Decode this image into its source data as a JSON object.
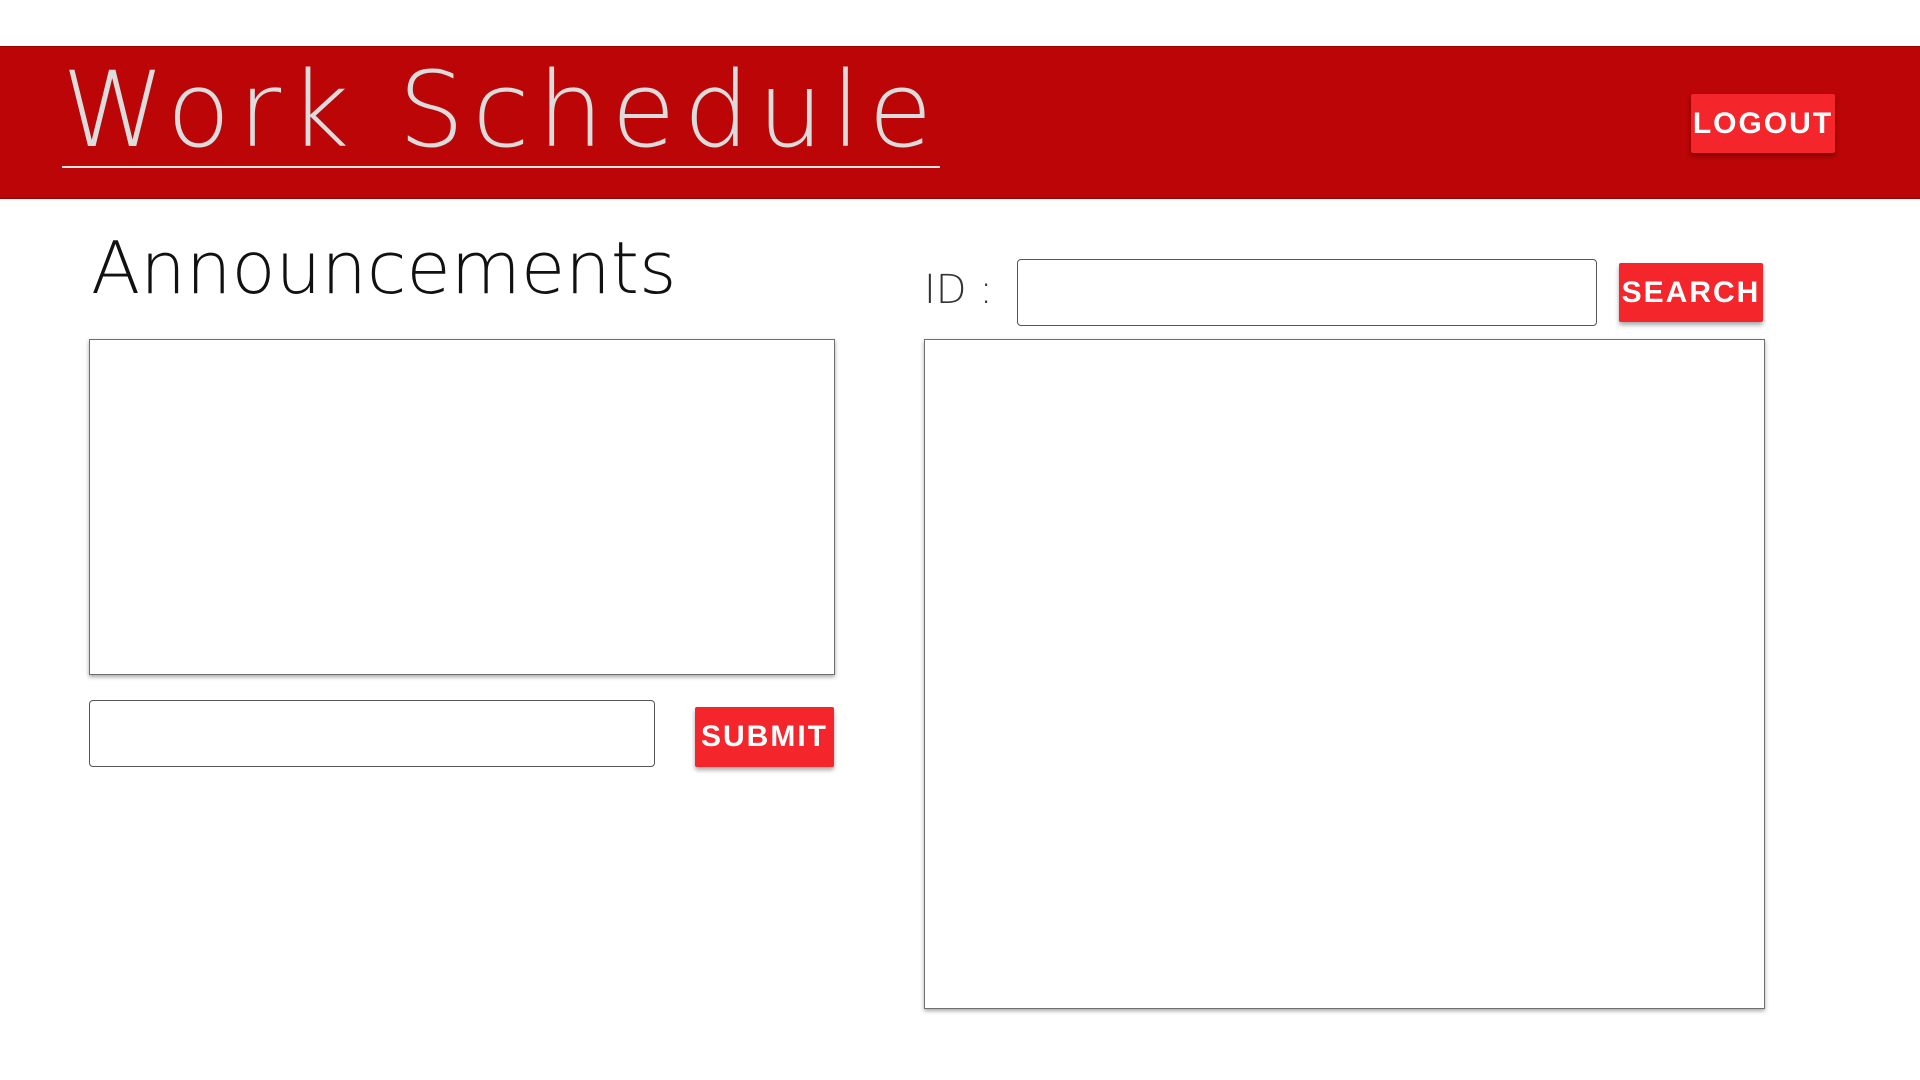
{
  "header": {
    "title": "Work Schedule",
    "logout_label": "LOGOUT"
  },
  "announcements": {
    "title": "Announcements",
    "input_value": "",
    "submit_label": "SUBMIT"
  },
  "search": {
    "id_label": "ID :",
    "input_value": "",
    "search_label": "SEARCH"
  },
  "colors": {
    "header_background": "#bc0506",
    "button_background": "#f4252b",
    "title_text": "#dcdcdc"
  }
}
